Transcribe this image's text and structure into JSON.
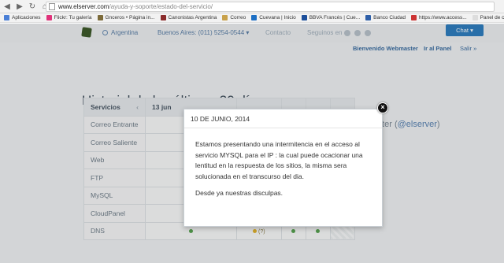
{
  "browser": {
    "url_host": "www.elserver.com",
    "url_path": "/ayuda-y-soporte/estado-del-servicio/",
    "bookmarks": [
      {
        "label": "Aplicaciones",
        "icon": "apps-icon",
        "color": "#4a7fd6"
      },
      {
        "label": "Flickr: Tu galería",
        "icon": "flickr-icon",
        "color": "#e0327a"
      },
      {
        "label": "Gnceros • Página in...",
        "icon": "page-icon",
        "color": "#7c6b3a"
      },
      {
        "label": "Canonistas Argentina",
        "icon": "page-icon",
        "color": "#8a2b2b"
      },
      {
        "label": "Correo",
        "icon": "mail-icon",
        "color": "#c8a14a"
      },
      {
        "label": "Cuevana | Inicio",
        "icon": "page-icon",
        "color": "#1d6fc4"
      },
      {
        "label": "BBVA Francés | Cue...",
        "icon": "page-icon",
        "color": "#1c4e9a"
      },
      {
        "label": "Banco Ciudad",
        "icon": "page-icon",
        "color": "#2e5fa8"
      },
      {
        "label": "https://www.access...",
        "icon": "page-icon",
        "color": "#c33"
      },
      {
        "label": "Panel de control",
        "icon": "document-icon",
        "color": "#ddd"
      }
    ]
  },
  "topnav": {
    "country": "Argentina",
    "phone": "Buenos Aires: (011) 5254-0544",
    "phone_caret": "▾",
    "contact": "Contacto",
    "follow": "Seguinos en",
    "chat": "Chat ▾",
    "welcome": "Bienvenido Webmaster",
    "panel": "Ir al Panel",
    "exit": "Salir »"
  },
  "status": {
    "heading": "Historial de los últimos 30 días",
    "twitter_prefix": "tter (",
    "twitter_handle": "@elserver",
    "twitter_suffix": ")",
    "col_service": "Servicios",
    "col_date": "13 jun",
    "prev_arrow": "‹",
    "services": [
      "Correo Entrante",
      "Correo Saliente",
      "Web",
      "FTP",
      "MySQL",
      "CloudPanel",
      "DNS"
    ],
    "warn_label": "(?)",
    "colors": {
      "ok": "#59a652",
      "warning": "#e5b52f"
    }
  },
  "modal": {
    "date": "10 DE JUNIO, 2014",
    "body": "Estamos presentando una intermitencia en el acceso al servicio MYSQL para el IP  :  la cual puede ocacionar una lentitud en la respuesta de los sitios,  la misma sera solucionada en el transcurso del dia.",
    "apology": "Desde ya nuestras disculpas.",
    "close": "×"
  }
}
